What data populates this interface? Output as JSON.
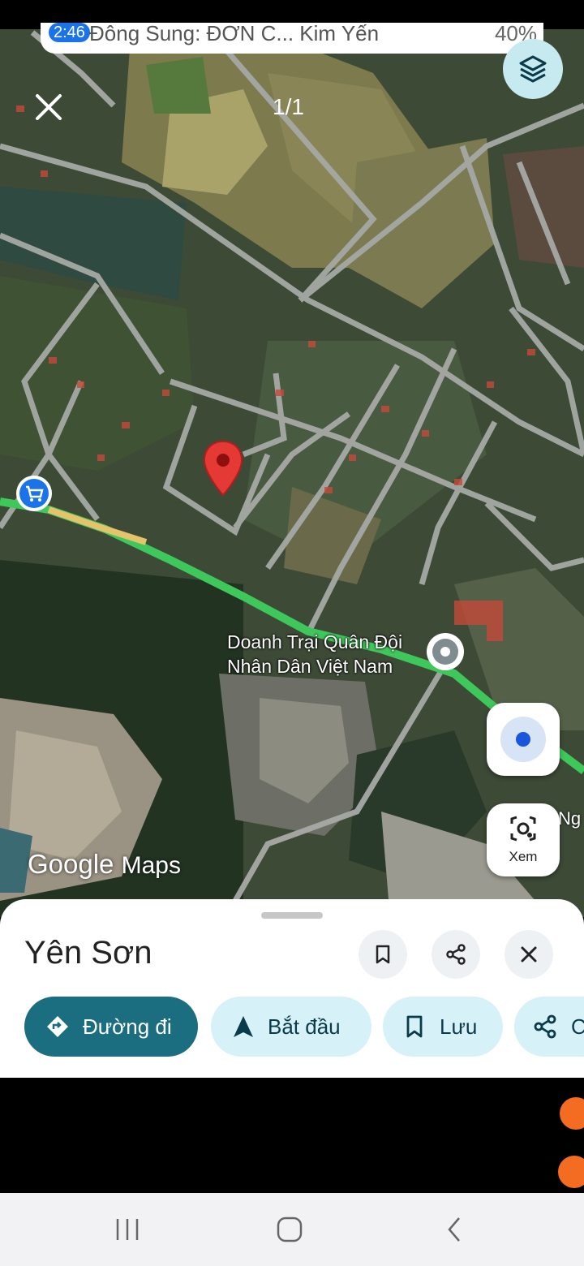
{
  "status_banner": {
    "time_badge": "2:46",
    "text": "Đông Sung: ĐƠN C... Kim Yến",
    "battery": "40%"
  },
  "viewer": {
    "counter": "1/1"
  },
  "map": {
    "poi_label_line1": "Doanh Trại Quân Đội",
    "poi_label_line2": "Nhân Dân Việt Nam",
    "road_label": "Ng",
    "watermark_google": "Google",
    "watermark_maps": "Maps",
    "lens_label": "Xem"
  },
  "place_sheet": {
    "title": "Yên Sơn",
    "actions": [
      {
        "label": "Đường đi",
        "icon": "directions-icon"
      },
      {
        "label": "Bắt đầu",
        "icon": "navigation-arrow-icon"
      },
      {
        "label": "Lưu",
        "icon": "bookmark-icon"
      },
      {
        "label": "C",
        "icon": "share-icon"
      }
    ]
  },
  "colors": {
    "route_green": "#3ec75a",
    "primary_chip": "#1b6e7f",
    "secondary_chip": "#d6f2f8",
    "pin_red": "#e53935"
  }
}
